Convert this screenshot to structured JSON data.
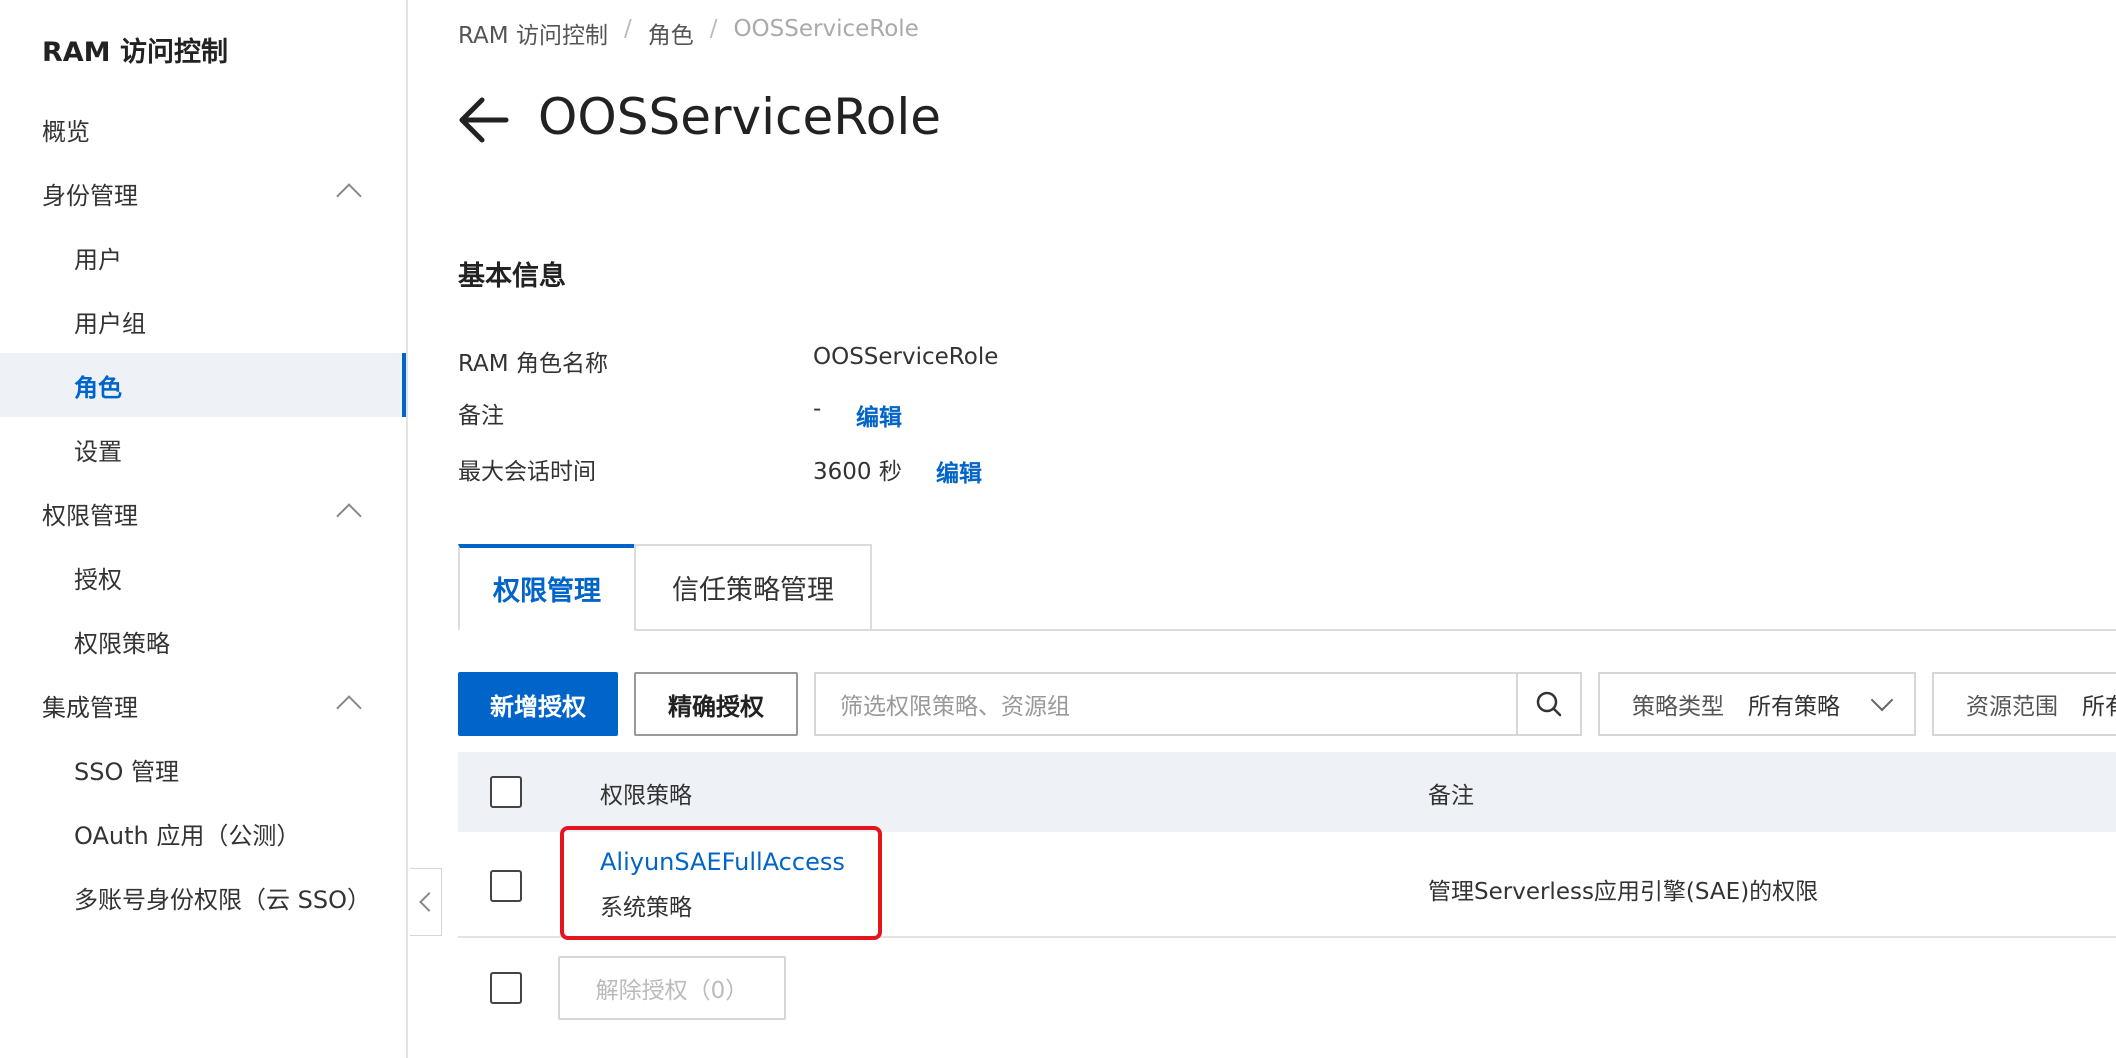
{
  "sidebar": {
    "title": "RAM 访问控制",
    "items": [
      {
        "label": "概览"
      },
      {
        "label": "身份管理"
      },
      {
        "label": "用户"
      },
      {
        "label": "用户组"
      },
      {
        "label": "角色"
      },
      {
        "label": "设置"
      },
      {
        "label": "权限管理"
      },
      {
        "label": "授权"
      },
      {
        "label": "权限策略"
      },
      {
        "label": "集成管理"
      },
      {
        "label": "SSO 管理"
      },
      {
        "label": "OAuth 应用（公测）"
      },
      {
        "label": "多账号身份权限（云 SSO）"
      }
    ],
    "active_item": "角色"
  },
  "breadcrumb": {
    "items": [
      "RAM 访问控制",
      "角色",
      "OOSServiceRole"
    ]
  },
  "header": {
    "title": "OOSServiceRole"
  },
  "basic_info": {
    "section_title": "基本信息",
    "role_name_label": "RAM 角色名称",
    "role_name_value": "OOSServiceRole",
    "note_label": "备注",
    "note_value": "-",
    "note_edit": "编辑",
    "max_session_label": "最大会话时间",
    "max_session_value": "3600 秒",
    "max_session_edit": "编辑"
  },
  "tabs": [
    {
      "label": "权限管理",
      "active": true
    },
    {
      "label": "信任策略管理",
      "active": false
    }
  ],
  "toolbar": {
    "add_grant": "新增授权",
    "precise_grant": "精确授权",
    "search_placeholder": "筛选权限策略、资源组",
    "policy_type_label": "策略类型",
    "policy_type_value": "所有策略",
    "resource_scope_label": "资源范围",
    "resource_scope_value": "所有"
  },
  "table": {
    "headers": {
      "policy": "权限策略",
      "note": "备注"
    },
    "rows": [
      {
        "policy_name": "AliyunSAEFullAccess",
        "policy_type": "系统策略",
        "note": "管理Serverless应用引擎(SAE)的权限"
      }
    ],
    "revoke_button": "解除授权（0）"
  },
  "colors": {
    "accent": "#0064c8",
    "highlight": "#e6141e"
  }
}
